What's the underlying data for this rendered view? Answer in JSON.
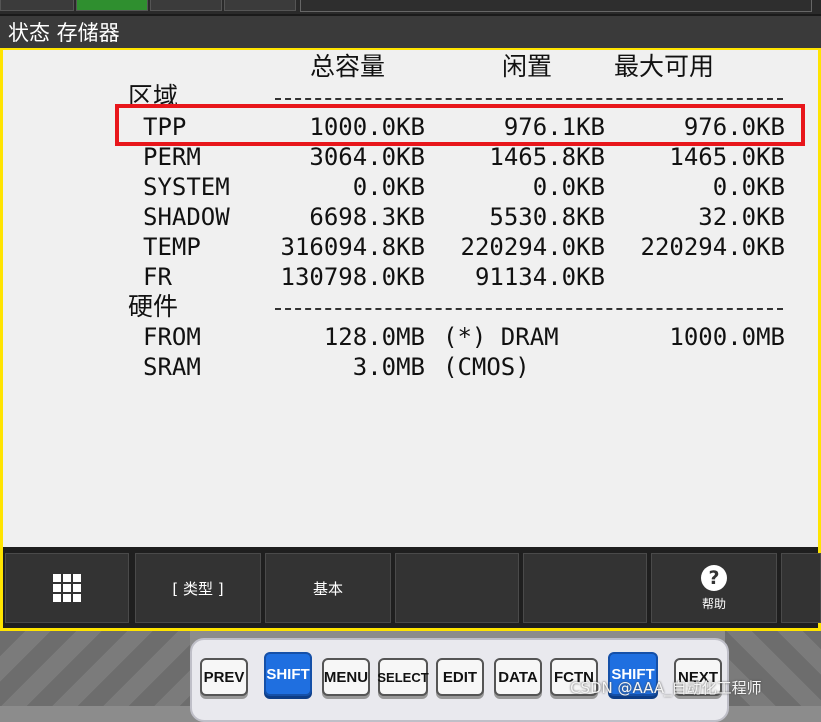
{
  "title": "状态 存储器",
  "headers": {
    "total": "总容量",
    "free": "闲置",
    "max_avail": "最大可用"
  },
  "sections": {
    "area": {
      "label": "区域",
      "rows": [
        {
          "name": "TPP",
          "total": "1000.0KB",
          "free": "976.1KB",
          "max": "976.0KB"
        },
        {
          "name": "PERM",
          "total": "3064.0KB",
          "free": "1465.8KB",
          "max": "1465.0KB"
        },
        {
          "name": "SYSTEM",
          "total": "0.0KB",
          "free": "0.0KB",
          "max": "0.0KB"
        },
        {
          "name": "SHADOW",
          "total": "6698.3KB",
          "free": "5530.8KB",
          "max": "32.0KB"
        },
        {
          "name": "TEMP",
          "total": "316094.8KB",
          "free": "220294.0KB",
          "max": "220294.0KB"
        },
        {
          "name": "FR",
          "total": "130798.0KB",
          "free": "91134.0KB",
          "max": ""
        }
      ]
    },
    "hardware": {
      "label": "硬件",
      "rows": [
        {
          "name": "FROM",
          "total": "128.0MB",
          "note": "(*) DRAM",
          "max": "1000.0MB"
        },
        {
          "name": "SRAM",
          "total": "3.0MB",
          "note": "(CMOS)",
          "max": ""
        }
      ]
    }
  },
  "softkeys": {
    "type": "[ 类型 ]",
    "basic": "基本",
    "help": "帮助"
  },
  "keypad": {
    "prev": "PREV",
    "shift_left": "SHIFT",
    "menu": "MENU",
    "select": "SELECT",
    "edit": "EDIT",
    "data": "DATA",
    "fctn": "FCTN",
    "shift_right": "SHIFT",
    "next": "NEXT"
  },
  "watermark": "CSDN @AAA_自动化工程师",
  "colors": {
    "highlight": "#e8161b",
    "frame": "#ffe400",
    "shift": "#1f6fe0"
  }
}
